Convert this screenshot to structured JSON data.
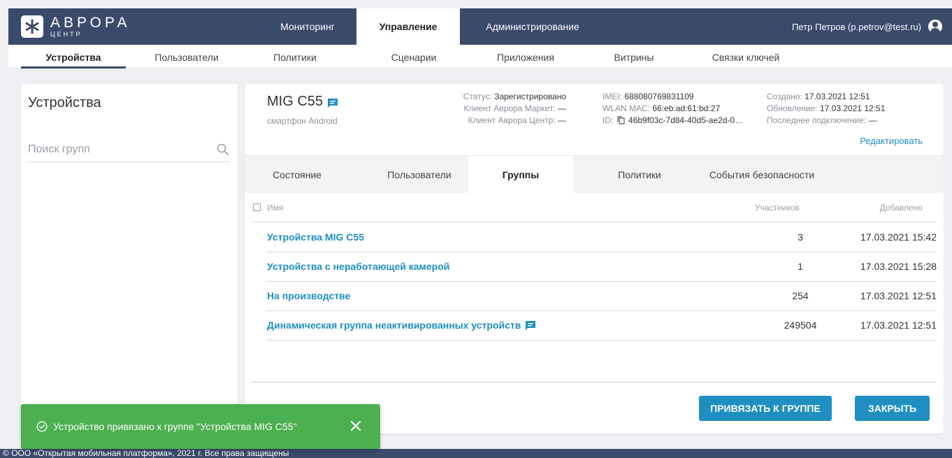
{
  "app": {
    "logo_title": "АВРОРА",
    "logo_subtitle": "ЦЕНТР",
    "logo_icon": "aurora-logo",
    "accent_color": "#1f8fc2",
    "header_color": "#3a4a6b"
  },
  "main_tabs": [
    {
      "label": "Мониторинг",
      "active": false
    },
    {
      "label": "Управление",
      "active": true
    },
    {
      "label": "Администрирование",
      "active": false
    }
  ],
  "user": {
    "name": "Петр Петров (p.petrov@test.ru)",
    "icon": "account-icon"
  },
  "sub_tabs": [
    {
      "label": "Устройства",
      "active": true
    },
    {
      "label": "Пользователи",
      "active": false
    },
    {
      "label": "Политики",
      "active": false
    },
    {
      "label": "Сценарии",
      "active": false
    },
    {
      "label": "Приложения",
      "active": false
    },
    {
      "label": "Витрины",
      "active": false
    },
    {
      "label": "Связки ключей",
      "active": false
    }
  ],
  "left": {
    "title": "Устройства",
    "search_placeholder": "Поиск групп",
    "search_icon": "search-icon"
  },
  "device": {
    "name": "MIG C55",
    "type": "смартфон Android",
    "status_label": "Статус:",
    "status_value": "Зарегистрировано",
    "market_label": "Клиент Аврора Маркет:",
    "market_value": "—",
    "center_label": "Клиент Аврора Центр:",
    "center_value": "—",
    "imei_label": "IMEI:",
    "imei_value": "688080769831109",
    "mac_label": "WLAN MAC:",
    "mac_value": "66:eb:ad:61:bd:27",
    "id_label": "ID:",
    "id_value": "46b9f03c-7d84-40d5-ae2d-0…",
    "created_label": "Создано:",
    "created_value": "17.03.2021 12:51",
    "updated_label": "Обновление:",
    "updated_value": "17.03.2021 12:51",
    "last_conn_label": "Последнее подключение:",
    "last_conn_value": "—",
    "edit_link": "Редактировать"
  },
  "detail_tabs": [
    {
      "label": "Состояние",
      "active": false
    },
    {
      "label": "Пользователи",
      "active": false
    },
    {
      "label": "Группы",
      "active": true
    },
    {
      "label": "Политики",
      "active": false
    },
    {
      "label": "События безопасности",
      "active": false
    }
  ],
  "table": {
    "col_name": "Имя",
    "col_members": "Участников",
    "col_added": "Добавлено",
    "rows": [
      {
        "name": "Устройства MIG C55",
        "members": "3",
        "added": "17.03.2021 15:42",
        "has_comment": false
      },
      {
        "name": "Устройства с неработающей камерой",
        "members": "1",
        "added": "17.03.2021 15:28",
        "has_comment": false
      },
      {
        "name": "На производстве",
        "members": "254",
        "added": "17.03.2021 12:51",
        "has_comment": false
      },
      {
        "name": "Динамическая группа неактивированных устройств",
        "members": "249504",
        "added": "17.03.2021 12:51",
        "has_comment": true
      }
    ]
  },
  "buttons": {
    "bind_group": "ПРИВЯЗАТЬ К ГРУППЕ",
    "close": "ЗАКРЫТЬ"
  },
  "toast": {
    "message": "Устройство привязано к группе \"Устройства MIG C55\"",
    "color": "#4caf50",
    "icon": "check-circle-icon",
    "close_icon": "close-icon"
  },
  "footer": {
    "text": "© ООО «Открытая мобильная платформа», 2021 г. Все права защищены"
  }
}
